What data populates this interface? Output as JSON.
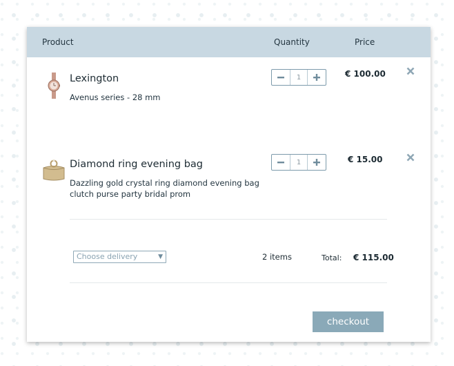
{
  "header": {
    "product": "Product",
    "quantity": "Quantity",
    "price": "Price"
  },
  "items": [
    {
      "name": "Lexington",
      "description": "Avenus series - 28 mm",
      "quantity": "1",
      "price": "€ 100.00",
      "image_icon": "wristwatch-image"
    },
    {
      "name": "Diamond ring evening bag",
      "description": "Dazzling gold crystal ring diamond evening bag clutch purse party bridal prom",
      "quantity": "1",
      "price": "€ 15.00",
      "image_icon": "clutch-bag-image"
    }
  ],
  "summary": {
    "delivery_placeholder": "Choose delivery",
    "items_count": "2 items",
    "total_label": "Total:",
    "total_value": "€ 115.00"
  },
  "checkout_label": "checkout",
  "colors": {
    "header_bg": "#c8d8e2",
    "accent": "#7c9aab",
    "checkout_bg": "#8aa9b8",
    "text": "#1d2b33"
  }
}
